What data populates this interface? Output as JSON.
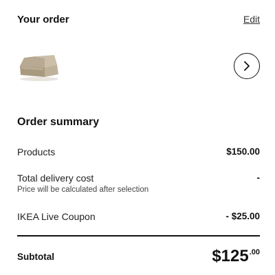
{
  "order": {
    "title": "Your order",
    "edit_label": "Edit"
  },
  "product": {
    "icon": "armchair-sofa-module-image"
  },
  "summary": {
    "title": "Order summary",
    "lines": [
      {
        "label": "Products",
        "value": "$150.00"
      },
      {
        "label": "Total delivery cost",
        "note": "Price will be calculated after selection",
        "value": "-"
      },
      {
        "label": "IKEA Live Coupon",
        "value": "- $25.00"
      }
    ],
    "subtotal": {
      "label": "Subtotal",
      "main": "$125",
      "cents": ".00"
    }
  },
  "colors": {
    "text": "#111111",
    "background": "#ffffff",
    "divider": "#111111"
  }
}
